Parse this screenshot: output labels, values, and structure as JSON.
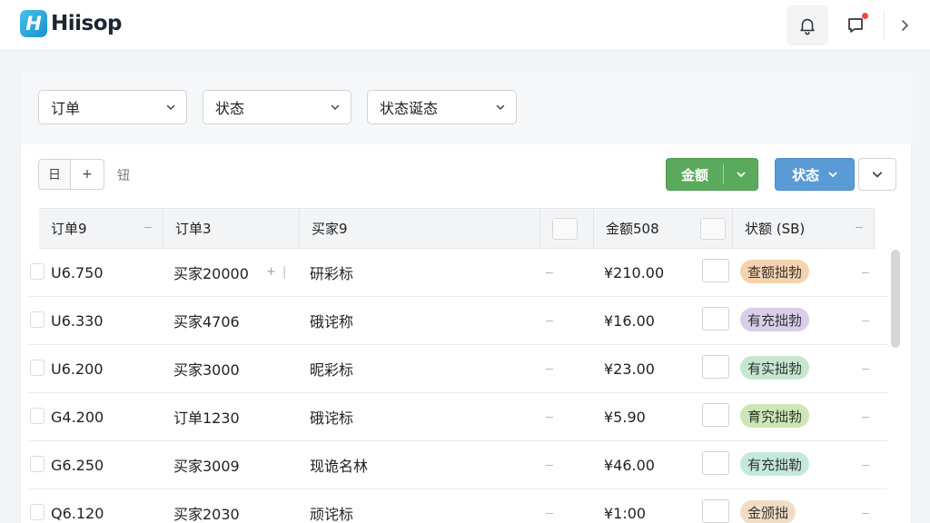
{
  "app": {
    "logo_letter": "H",
    "name": "Hiisop"
  },
  "filters": [
    {
      "label": "订单"
    },
    {
      "label": "状态"
    },
    {
      "label": "状态诞态"
    }
  ],
  "toolbar": {
    "view_btn": "日",
    "add_btn": "+",
    "label": "钮",
    "green_btn": "金额",
    "blue_btn": "状态"
  },
  "table": {
    "columns": [
      "订单9",
      "订单3",
      "买家9",
      "",
      "金额508",
      "",
      "状额 (SB)"
    ],
    "rows": [
      {
        "id": "U6.750",
        "buyer": "买家20000",
        "name": "研彩标",
        "amount": "¥210.00",
        "status": "查额拙勃",
        "status_color": "#f5d3ae"
      },
      {
        "id": "U6.330",
        "buyer": "买家4706",
        "name": "硪诧称",
        "amount": "¥16.00",
        "status": "有充拙勃",
        "status_color": "#d9cdea"
      },
      {
        "id": "U6.200",
        "buyer": "买家3000",
        "name": "昵彩标",
        "amount": "¥23.00",
        "status": "有实拙勃",
        "status_color": "#c7e6d2"
      },
      {
        "id": "G4.200",
        "buyer": "订单1230",
        "name": "硪诧标",
        "amount": "¥5.90",
        "status": "育究拙勃",
        "status_color": "#cde6b5"
      },
      {
        "id": "G6.250",
        "buyer": "买家3009",
        "name": "现诡名林",
        "amount": "¥46.00",
        "status": "有充拙勒",
        "status_color": "#c5e8dc"
      },
      {
        "id": "Q6.120",
        "buyer": "买家2030",
        "name": "顽诧标",
        "amount": "¥1:00",
        "status": "金颁拙",
        "status_color": "#f1dcc5"
      }
    ]
  },
  "icons": {
    "bell": "bell-icon",
    "chat": "chat-notification-icon",
    "more": "chevron-right-icon"
  }
}
